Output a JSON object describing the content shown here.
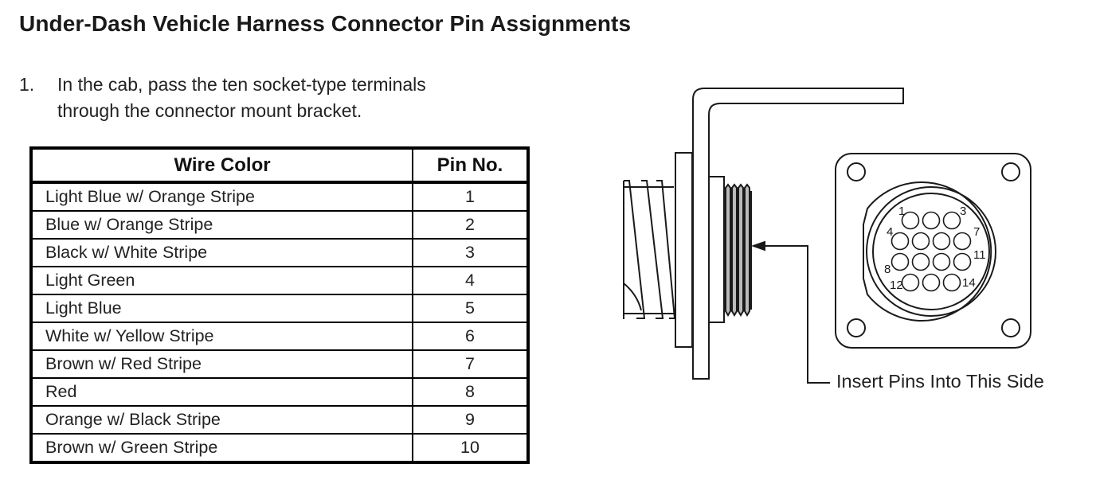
{
  "page": {
    "title": "Under-Dash Vehicle Harness Connector Pin Assignments"
  },
  "step": {
    "number": "1.",
    "line1": "In the cab, pass the ten socket-type terminals",
    "line2": "through the connector mount bracket."
  },
  "table": {
    "headers": {
      "wire_color": "Wire Color",
      "pin_no": "Pin No."
    },
    "rows": [
      {
        "color": "Light Blue w/ Orange Stripe",
        "pin": "1"
      },
      {
        "color": "Blue w/ Orange Stripe",
        "pin": "2"
      },
      {
        "color": "Black w/ White Stripe",
        "pin": "3"
      },
      {
        "color": "Light Green",
        "pin": "4"
      },
      {
        "color": "Light Blue",
        "pin": "5"
      },
      {
        "color": "White w/ Yellow Stripe",
        "pin": "6"
      },
      {
        "color": "Brown w/ Red Stripe",
        "pin": "7"
      },
      {
        "color": "Red",
        "pin": "8"
      },
      {
        "color": "Orange w/ Black Stripe",
        "pin": "9"
      },
      {
        "color": "Brown w/ Green Stripe",
        "pin": "10"
      }
    ]
  },
  "diagram": {
    "callout": "Insert Pins Into This Side",
    "pin_labels": {
      "p1": "1",
      "p3": "3",
      "p4": "4",
      "p7": "7",
      "p8": "8",
      "p11": "11",
      "p12": "12",
      "p14": "14"
    },
    "pin_rows": [
      3,
      4,
      4,
      3
    ]
  }
}
